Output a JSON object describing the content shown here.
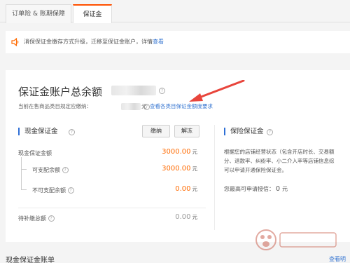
{
  "tabs": [
    {
      "label": "订单险 & 账期保障"
    },
    {
      "label": "保证金"
    }
  ],
  "notice": {
    "text": "消保保证金缴存方式升级，迁移至保证金账户，详情",
    "link": "查看"
  },
  "summary": {
    "title": "保证金账户总余额",
    "line_prefix": "当前在售商品类目规定应缴纳：",
    "line_suffix": "元",
    "link": "查看各类目保证金额度要求"
  },
  "cash_section": {
    "title": "现金保证金",
    "deposit_button": "缴纳",
    "unfreeze_button": "解冻",
    "rows": [
      {
        "label": "现金保证金额",
        "value": "3000.00",
        "unit": "元"
      },
      {
        "label": "可支配余额",
        "value": "3000.00",
        "unit": "元"
      },
      {
        "label": "不可支配余额",
        "value": "0.00",
        "unit": "元"
      },
      {
        "label": "待补缴总额",
        "value": "0.00",
        "unit": "元"
      }
    ]
  },
  "insurance_section": {
    "title": "保险保证金",
    "desc_lines": [
      "根据您的店铺经营状态（包含开店时长、交易额",
      "分、退款率、纠纷率、小二介入率等店铺信息综",
      "可以申请开通保险保证金。"
    ],
    "credit_label": "您最高可申请授信：",
    "credit_value": "0",
    "credit_unit": "元"
  },
  "bottom": {
    "title": "现金保证金账单",
    "link": "查看明"
  },
  "colors": {
    "accent": "#ff6a00",
    "link": "#3a78d2",
    "tab_active": "#ff5000",
    "arrow": "#e8453c"
  }
}
